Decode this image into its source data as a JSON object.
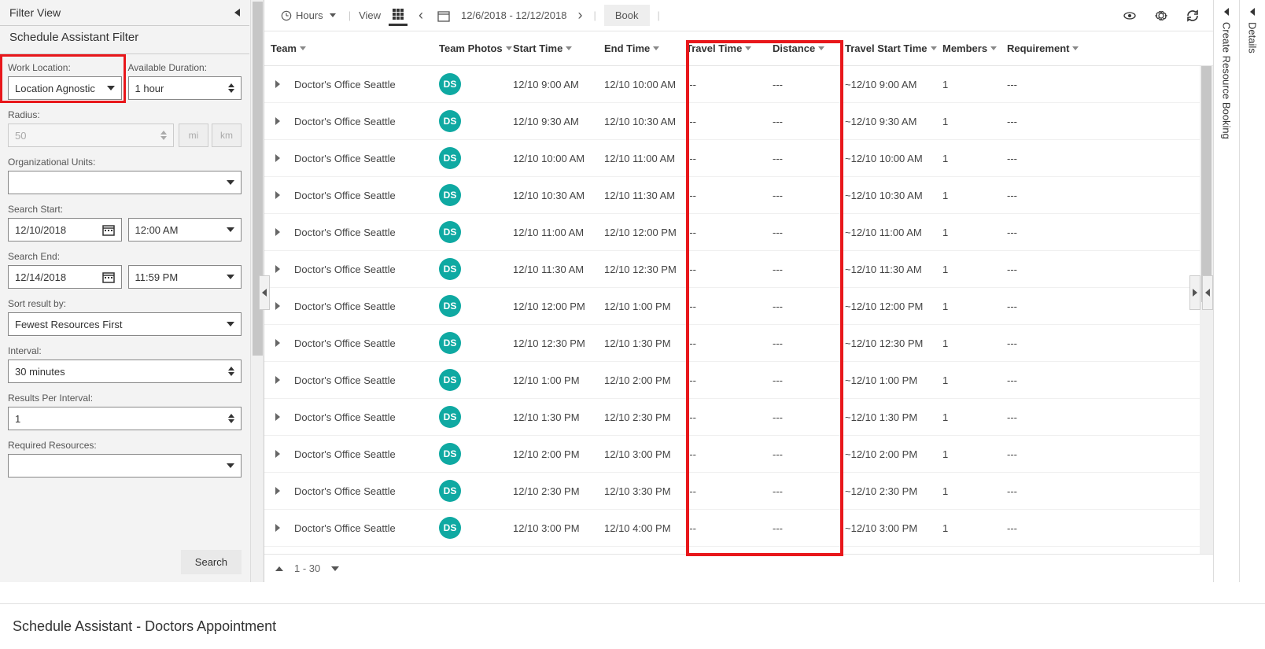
{
  "filter": {
    "header": "Filter View",
    "subheader": "Schedule Assistant Filter",
    "work_location_label": "Work Location:",
    "work_location_value": "Location Agnostic",
    "available_duration_label": "Available Duration:",
    "available_duration_value": "1 hour",
    "radius_label": "Radius:",
    "radius_value": "50",
    "unit_mi": "mi",
    "unit_km": "km",
    "org_units_label": "Organizational Units:",
    "org_units_value": "",
    "search_start_label": "Search Start:",
    "search_start_date": "12/10/2018",
    "search_start_time": "12:00 AM",
    "search_end_label": "Search End:",
    "search_end_date": "12/14/2018",
    "search_end_time": "11:59 PM",
    "sort_label": "Sort result by:",
    "sort_value": "Fewest Resources First",
    "interval_label": "Interval:",
    "interval_value": "30 minutes",
    "results_per_label": "Results Per Interval:",
    "results_per_value": "1",
    "required_resources_label": "Required Resources:",
    "search_btn": "Search"
  },
  "toolbar": {
    "hours": "Hours",
    "view": "View",
    "date_range": "12/6/2018 - 12/12/2018",
    "book": "Book"
  },
  "grid": {
    "columns": {
      "team": "Team",
      "photos": "Team Photos",
      "start": "Start Time",
      "end": "End Time",
      "travel": "Travel Time",
      "distance": "Distance",
      "travel_start": "Travel Start Time",
      "members": "Members",
      "requirement": "Requirement"
    },
    "avatar_initials": "DS",
    "rows": [
      {
        "team": "Doctor's Office Seattle",
        "start": "12/10 9:00 AM",
        "end": "12/10 10:00 AM",
        "travel": "---",
        "distance": "---",
        "travel_start": "~12/10 9:00 AM",
        "members": "1",
        "req": "---"
      },
      {
        "team": "Doctor's Office Seattle",
        "start": "12/10 9:30 AM",
        "end": "12/10 10:30 AM",
        "travel": "---",
        "distance": "---",
        "travel_start": "~12/10 9:30 AM",
        "members": "1",
        "req": "---"
      },
      {
        "team": "Doctor's Office Seattle",
        "start": "12/10 10:00 AM",
        "end": "12/10 11:00 AM",
        "travel": "---",
        "distance": "---",
        "travel_start": "~12/10 10:00 AM",
        "members": "1",
        "req": "---"
      },
      {
        "team": "Doctor's Office Seattle",
        "start": "12/10 10:30 AM",
        "end": "12/10 11:30 AM",
        "travel": "---",
        "distance": "---",
        "travel_start": "~12/10 10:30 AM",
        "members": "1",
        "req": "---"
      },
      {
        "team": "Doctor's Office Seattle",
        "start": "12/10 11:00 AM",
        "end": "12/10 12:00 PM",
        "travel": "---",
        "distance": "---",
        "travel_start": "~12/10 11:00 AM",
        "members": "1",
        "req": "---"
      },
      {
        "team": "Doctor's Office Seattle",
        "start": "12/10 11:30 AM",
        "end": "12/10 12:30 PM",
        "travel": "---",
        "distance": "---",
        "travel_start": "~12/10 11:30 AM",
        "members": "1",
        "req": "---"
      },
      {
        "team": "Doctor's Office Seattle",
        "start": "12/10 12:00 PM",
        "end": "12/10 1:00 PM",
        "travel": "---",
        "distance": "---",
        "travel_start": "~12/10 12:00 PM",
        "members": "1",
        "req": "---"
      },
      {
        "team": "Doctor's Office Seattle",
        "start": "12/10 12:30 PM",
        "end": "12/10 1:30 PM",
        "travel": "---",
        "distance": "---",
        "travel_start": "~12/10 12:30 PM",
        "members": "1",
        "req": "---"
      },
      {
        "team": "Doctor's Office Seattle",
        "start": "12/10 1:00 PM",
        "end": "12/10 2:00 PM",
        "travel": "---",
        "distance": "---",
        "travel_start": "~12/10 1:00 PM",
        "members": "1",
        "req": "---"
      },
      {
        "team": "Doctor's Office Seattle",
        "start": "12/10 1:30 PM",
        "end": "12/10 2:30 PM",
        "travel": "---",
        "distance": "---",
        "travel_start": "~12/10 1:30 PM",
        "members": "1",
        "req": "---"
      },
      {
        "team": "Doctor's Office Seattle",
        "start": "12/10 2:00 PM",
        "end": "12/10 3:00 PM",
        "travel": "---",
        "distance": "---",
        "travel_start": "~12/10 2:00 PM",
        "members": "1",
        "req": "---"
      },
      {
        "team": "Doctor's Office Seattle",
        "start": "12/10 2:30 PM",
        "end": "12/10 3:30 PM",
        "travel": "---",
        "distance": "---",
        "travel_start": "~12/10 2:30 PM",
        "members": "1",
        "req": "---"
      },
      {
        "team": "Doctor's Office Seattle",
        "start": "12/10 3:00 PM",
        "end": "12/10 4:00 PM",
        "travel": "---",
        "distance": "---",
        "travel_start": "~12/10 3:00 PM",
        "members": "1",
        "req": "---"
      }
    ],
    "pager": "1 - 30"
  },
  "right": {
    "create": "Create Resource Booking",
    "details": "Details"
  },
  "footer": "Schedule Assistant - Doctors Appointment"
}
